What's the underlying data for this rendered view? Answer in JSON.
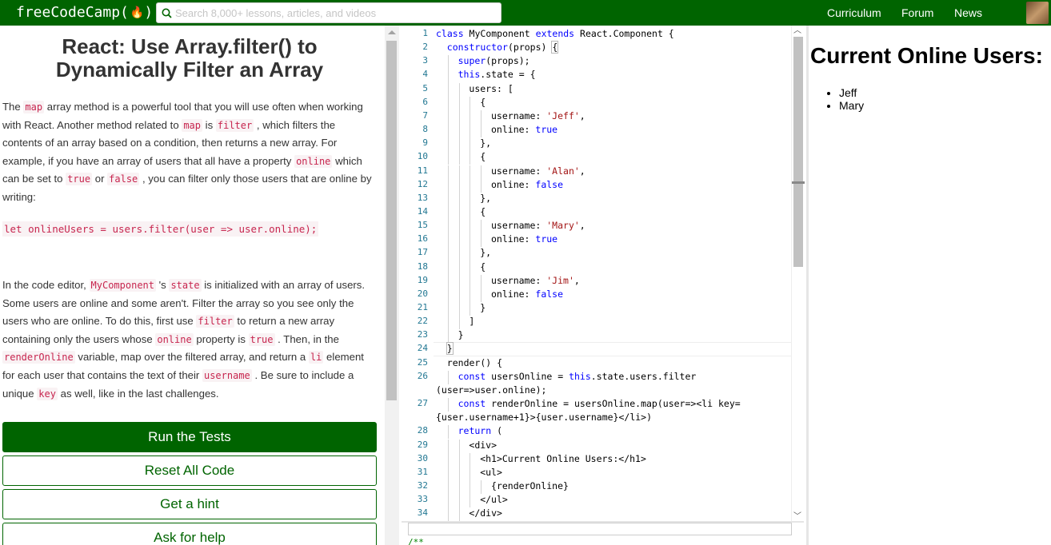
{
  "nav": {
    "logo_text": "freeCodeCamp(",
    "logo_flame": "🔥",
    "logo_close": ")",
    "search_placeholder": "Search 8,000+ lessons, articles, and videos",
    "links": [
      "Curriculum",
      "Forum",
      "News"
    ]
  },
  "challenge": {
    "title": "React: Use Array.filter() to Dynamically Filter an Array",
    "p1": [
      {
        "t": "The "
      },
      {
        "c": "map"
      },
      {
        "t": " array method is a powerful tool that you will use often when working with React. Another method related to "
      },
      {
        "c": "map"
      },
      {
        "t": " is "
      },
      {
        "c": "filter"
      },
      {
        "t": " , which filters the contents of an array based on a condition, then returns a new array. For example, if you have an array of users that all have a property "
      },
      {
        "c": "online"
      },
      {
        "t": " which can be set to "
      },
      {
        "c": "true"
      },
      {
        "t": " or "
      },
      {
        "c": "false"
      },
      {
        "t": " , you can filter only those users that are online by writing:"
      }
    ],
    "example": "let onlineUsers = users.filter(user => user.online);",
    "p2": [
      {
        "t": "In the code editor, "
      },
      {
        "c": "MyComponent"
      },
      {
        "t": " 's "
      },
      {
        "c": "state"
      },
      {
        "t": " is initialized with an array of users. Some users are online and some aren't. Filter the array so you see only the users who are online. To do this, first use "
      },
      {
        "c": "filter"
      },
      {
        "t": " to return a new array containing only the users whose "
      },
      {
        "c": "online"
      },
      {
        "t": " property is "
      },
      {
        "c": "true"
      },
      {
        "t": " . Then, in the "
      },
      {
        "c": "renderOnline"
      },
      {
        "t": " variable, map over the filtered array, and return a "
      },
      {
        "c": "li"
      },
      {
        "t": " element for each user that contains the text of their "
      },
      {
        "c": "username"
      },
      {
        "t": " . Be sure to include a unique "
      },
      {
        "c": "key"
      },
      {
        "t": " as well, like in the last challenges."
      }
    ],
    "buttons": [
      "Run the Tests",
      "Reset All Code",
      "Get a hint",
      "Ask for help"
    ]
  },
  "editor": {
    "lines": [
      {
        "n": "1",
        "indent": 0,
        "parts": [
          {
            "k": "class"
          },
          {
            "p": " MyComponent "
          },
          {
            "k": "extends"
          },
          {
            "p": " React.Component {"
          }
        ]
      },
      {
        "n": "2",
        "indent": 1,
        "parts": [
          {
            "k": "constructor"
          },
          {
            "p": "(props) "
          },
          {
            "b": "{"
          }
        ]
      },
      {
        "n": "3",
        "indent": 2,
        "parts": [
          {
            "k": "super"
          },
          {
            "p": "(props);"
          }
        ]
      },
      {
        "n": "4",
        "indent": 2,
        "parts": [
          {
            "k": "this"
          },
          {
            "p": ".state = {"
          }
        ]
      },
      {
        "n": "5",
        "indent": 3,
        "parts": [
          {
            "p": "users: ["
          }
        ]
      },
      {
        "n": "6",
        "indent": 4,
        "parts": [
          {
            "p": "{"
          }
        ]
      },
      {
        "n": "7",
        "indent": 5,
        "parts": [
          {
            "p": "username: "
          },
          {
            "s": "'Jeff'"
          },
          {
            "p": ","
          }
        ]
      },
      {
        "n": "8",
        "indent": 5,
        "parts": [
          {
            "p": "online: "
          },
          {
            "k": "true"
          }
        ]
      },
      {
        "n": "9",
        "indent": 4,
        "parts": [
          {
            "p": "},"
          }
        ]
      },
      {
        "n": "10",
        "indent": 4,
        "parts": [
          {
            "p": "{"
          }
        ]
      },
      {
        "n": "11",
        "indent": 5,
        "parts": [
          {
            "p": "username: "
          },
          {
            "s": "'Alan'"
          },
          {
            "p": ","
          }
        ]
      },
      {
        "n": "12",
        "indent": 5,
        "parts": [
          {
            "p": "online: "
          },
          {
            "k": "false"
          }
        ]
      },
      {
        "n": "13",
        "indent": 4,
        "parts": [
          {
            "p": "},"
          }
        ]
      },
      {
        "n": "14",
        "indent": 4,
        "parts": [
          {
            "p": "{"
          }
        ]
      },
      {
        "n": "15",
        "indent": 5,
        "parts": [
          {
            "p": "username: "
          },
          {
            "s": "'Mary'"
          },
          {
            "p": ","
          }
        ]
      },
      {
        "n": "16",
        "indent": 5,
        "parts": [
          {
            "p": "online: "
          },
          {
            "k": "true"
          }
        ]
      },
      {
        "n": "17",
        "indent": 4,
        "parts": [
          {
            "p": "},"
          }
        ]
      },
      {
        "n": "18",
        "indent": 4,
        "parts": [
          {
            "p": "{"
          }
        ]
      },
      {
        "n": "19",
        "indent": 5,
        "parts": [
          {
            "p": "username: "
          },
          {
            "s": "'Jim'"
          },
          {
            "p": ","
          }
        ]
      },
      {
        "n": "20",
        "indent": 5,
        "parts": [
          {
            "p": "online: "
          },
          {
            "k": "false"
          }
        ]
      },
      {
        "n": "21",
        "indent": 4,
        "parts": [
          {
            "p": "}"
          }
        ]
      },
      {
        "n": "22",
        "indent": 3,
        "parts": [
          {
            "p": "]"
          }
        ]
      },
      {
        "n": "23",
        "indent": 2,
        "parts": [
          {
            "p": "}"
          }
        ]
      },
      {
        "n": "24",
        "indent": 1,
        "parts": [
          {
            "b": "}"
          }
        ]
      },
      {
        "n": "25",
        "indent": 1,
        "parts": [
          {
            "p": "render() {"
          }
        ]
      },
      {
        "n": "26",
        "indent": 2,
        "parts": [
          {
            "k": "const"
          },
          {
            "p": " usersOnline = "
          },
          {
            "k": "this"
          },
          {
            "p": ".state.users.filter"
          }
        ]
      },
      {
        "n": "",
        "indent": 0,
        "parts": [
          {
            "p": "(user=>user.online);"
          }
        ]
      },
      {
        "n": "27",
        "indent": 2,
        "parts": [
          {
            "k": "const"
          },
          {
            "p": " renderOnline = usersOnline.map(user=><li key="
          }
        ]
      },
      {
        "n": "",
        "indent": 0,
        "parts": [
          {
            "p": "{user.username+1}>{user.username}</li>)"
          }
        ]
      },
      {
        "n": "28",
        "indent": 2,
        "parts": [
          {
            "k": "return"
          },
          {
            "p": " ("
          }
        ]
      },
      {
        "n": "29",
        "indent": 3,
        "parts": [
          {
            "p": "<div>"
          }
        ]
      },
      {
        "n": "30",
        "indent": 4,
        "parts": [
          {
            "p": "<h1>Current Online Users:</h1>"
          }
        ]
      },
      {
        "n": "31",
        "indent": 4,
        "parts": [
          {
            "p": "<ul>"
          }
        ]
      },
      {
        "n": "32",
        "indent": 5,
        "parts": [
          {
            "p": "{renderOnline}"
          }
        ]
      },
      {
        "n": "33",
        "indent": 4,
        "parts": [
          {
            "p": "</ul>"
          }
        ]
      },
      {
        "n": "34",
        "indent": 3,
        "parts": [
          {
            "p": "</div>"
          }
        ]
      }
    ],
    "console_comment": "/**"
  },
  "preview": {
    "heading": "Current Online Users:",
    "users": [
      "Jeff",
      "Mary"
    ]
  }
}
